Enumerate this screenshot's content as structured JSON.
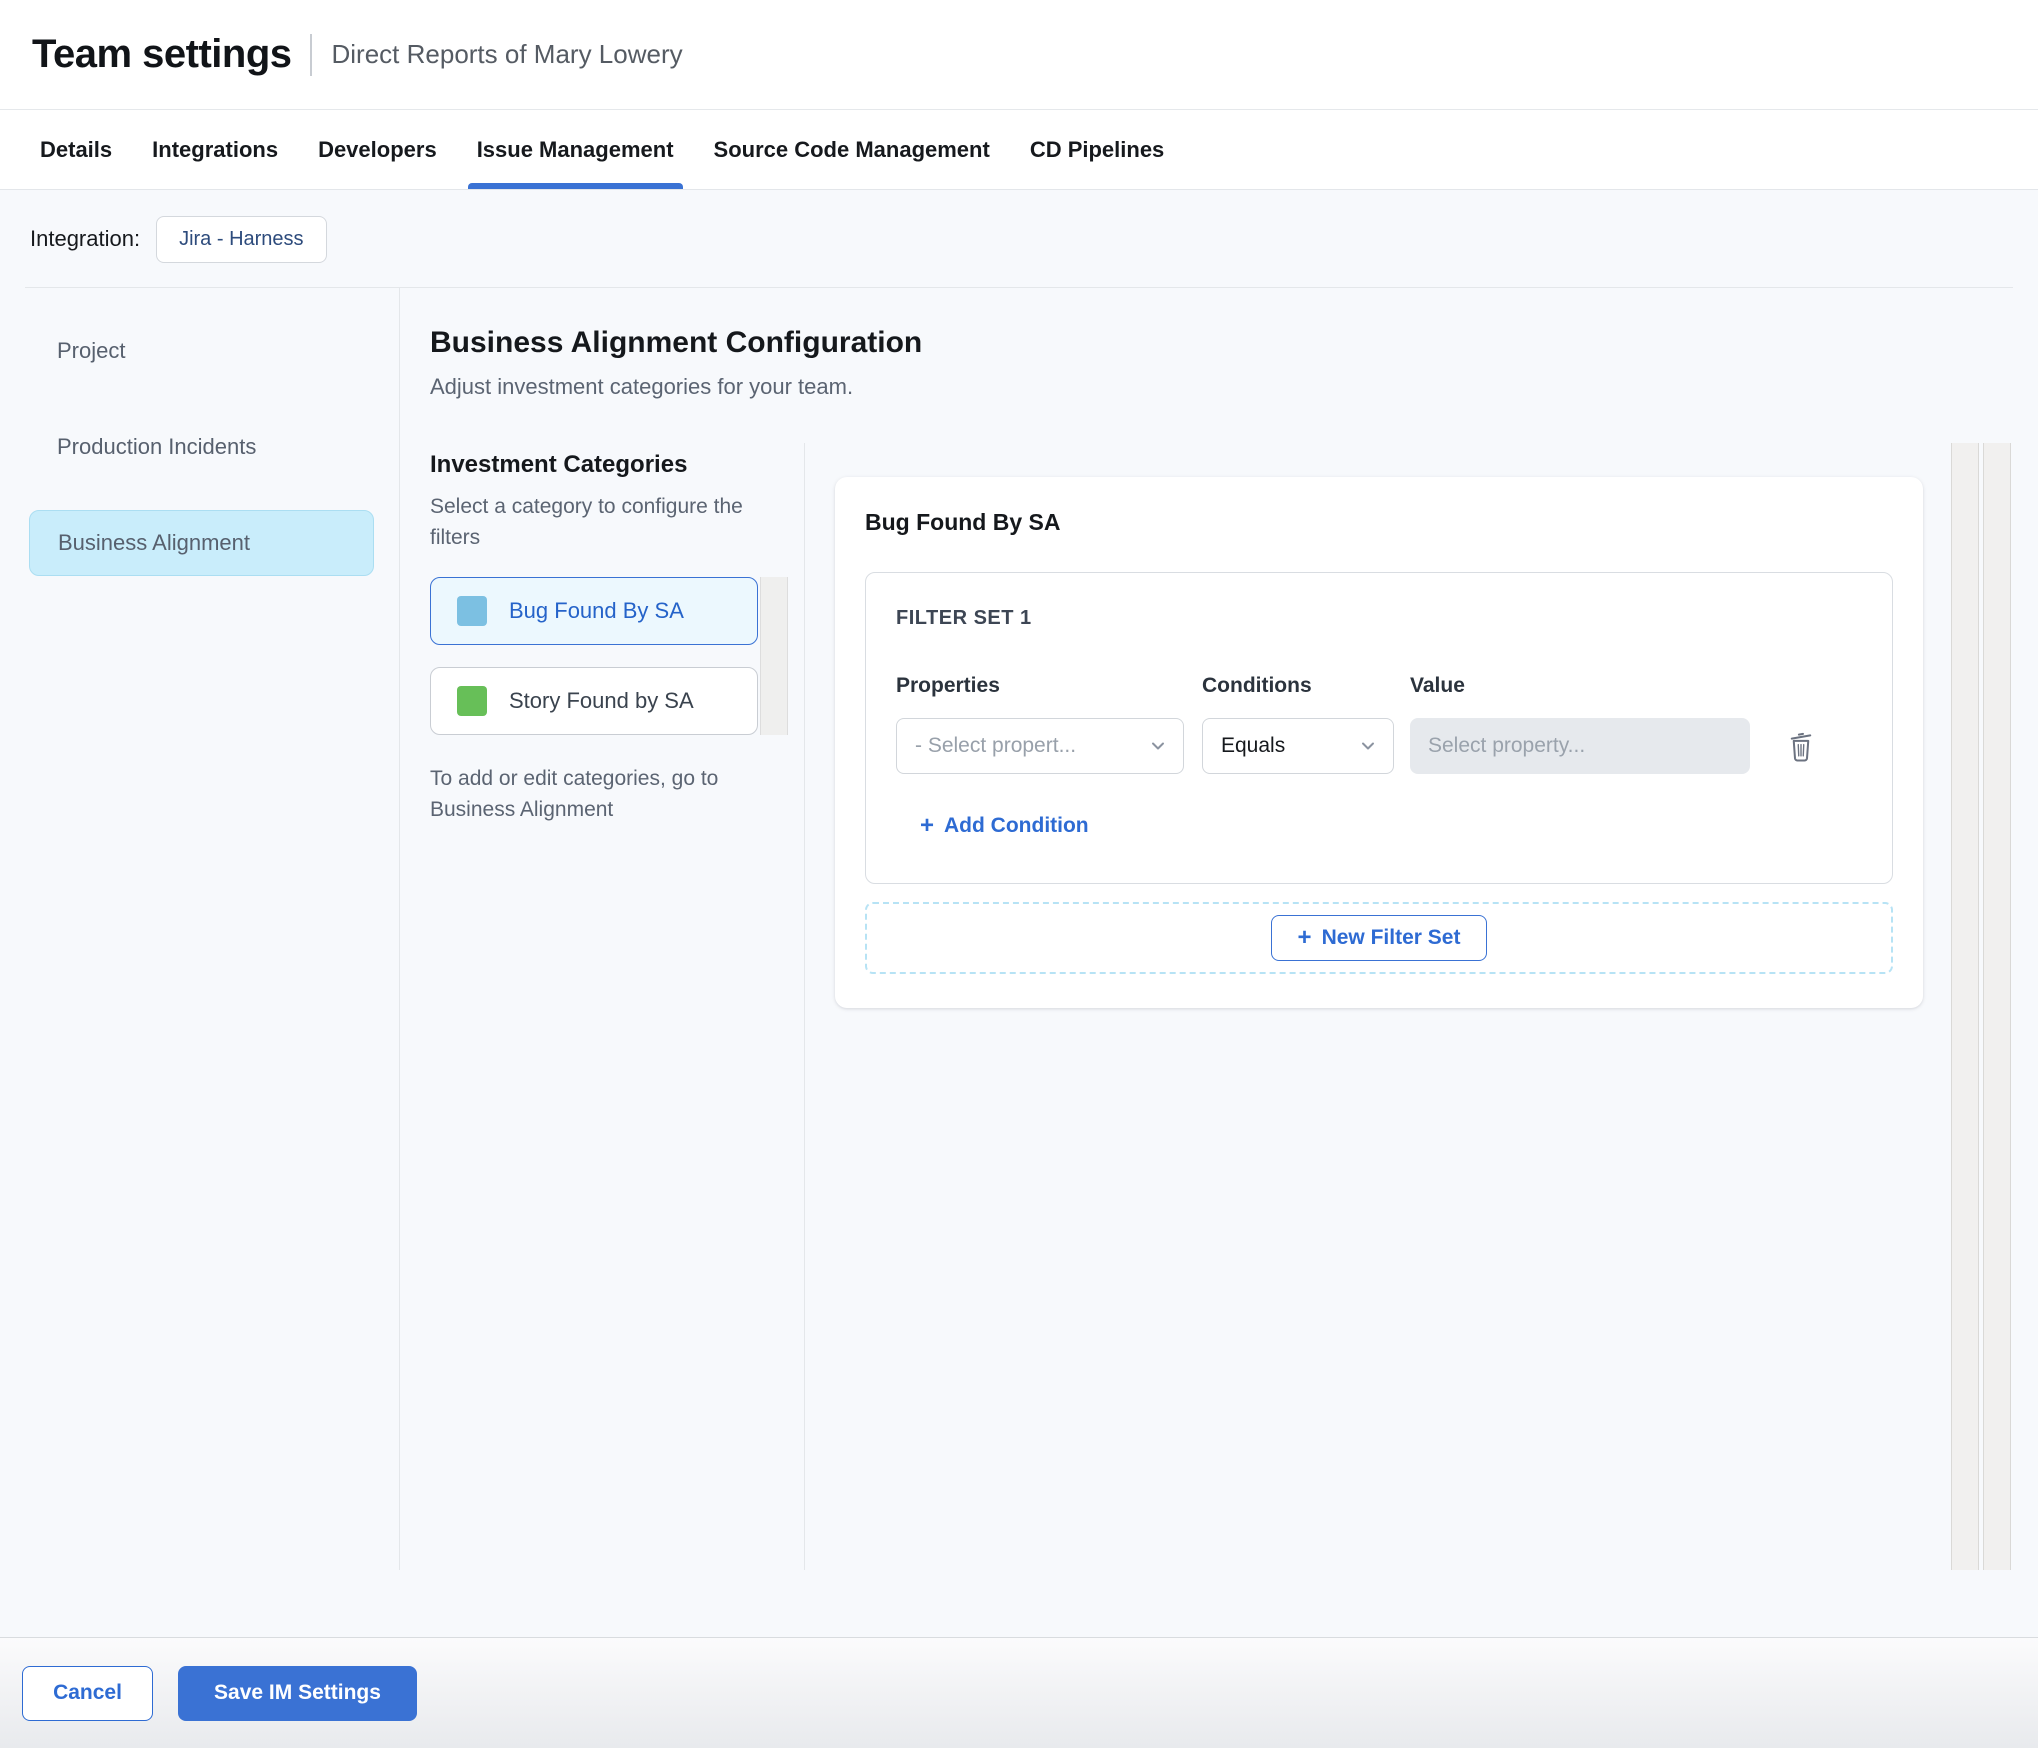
{
  "header": {
    "title": "Team settings",
    "subtitle": "Direct Reports of Mary Lowery"
  },
  "tabs": {
    "items": [
      {
        "label": "Details",
        "active": false
      },
      {
        "label": "Integrations",
        "active": false
      },
      {
        "label": "Developers",
        "active": false
      },
      {
        "label": "Issue Management",
        "active": true
      },
      {
        "label": "Source Code Management",
        "active": false
      },
      {
        "label": "CD Pipelines",
        "active": false
      }
    ]
  },
  "integration": {
    "label": "Integration:",
    "chip": "Jira - Harness"
  },
  "sidebar": {
    "items": [
      {
        "label": "Project",
        "selected": false
      },
      {
        "label": "Production Incidents",
        "selected": false
      },
      {
        "label": "Business Alignment",
        "selected": true
      }
    ]
  },
  "main": {
    "heading": "Business Alignment Configuration",
    "subheading": "Adjust investment categories for your team.",
    "categories": {
      "title": "Investment Categories",
      "description": "Select a category to configure the filters",
      "items": [
        {
          "label": "Bug Found By SA",
          "swatch": "#7cc0e2",
          "selected": true
        },
        {
          "label": "Story Found by SA",
          "swatch": "#67bf58",
          "selected": false
        }
      ],
      "note": "To add or edit categories, go to Business Alignment"
    },
    "panel": {
      "title": "Bug Found By SA",
      "filter_set": {
        "title": "FILTER SET 1",
        "columns": [
          "Properties",
          "Conditions",
          "Value"
        ],
        "property_placeholder": "- Select propert...",
        "condition_value": "Equals",
        "value_placeholder": "Select property...",
        "add_condition_label": "Add Condition"
      },
      "new_filter_set_label": "New Filter Set"
    }
  },
  "footer": {
    "cancel_label": "Cancel",
    "save_label": "Save IM Settings"
  },
  "icons": {
    "plus": "+"
  },
  "colors": {
    "accent_blue": "#3a72d4",
    "link_blue": "#2e6bd3",
    "bug_swatch": "#7cc0e2",
    "story_swatch": "#67bf58",
    "sidebar_selected_bg": "#c9edfb",
    "category_selected_bg": "#ecf8fe",
    "content_bg": "#f7f9fc"
  }
}
